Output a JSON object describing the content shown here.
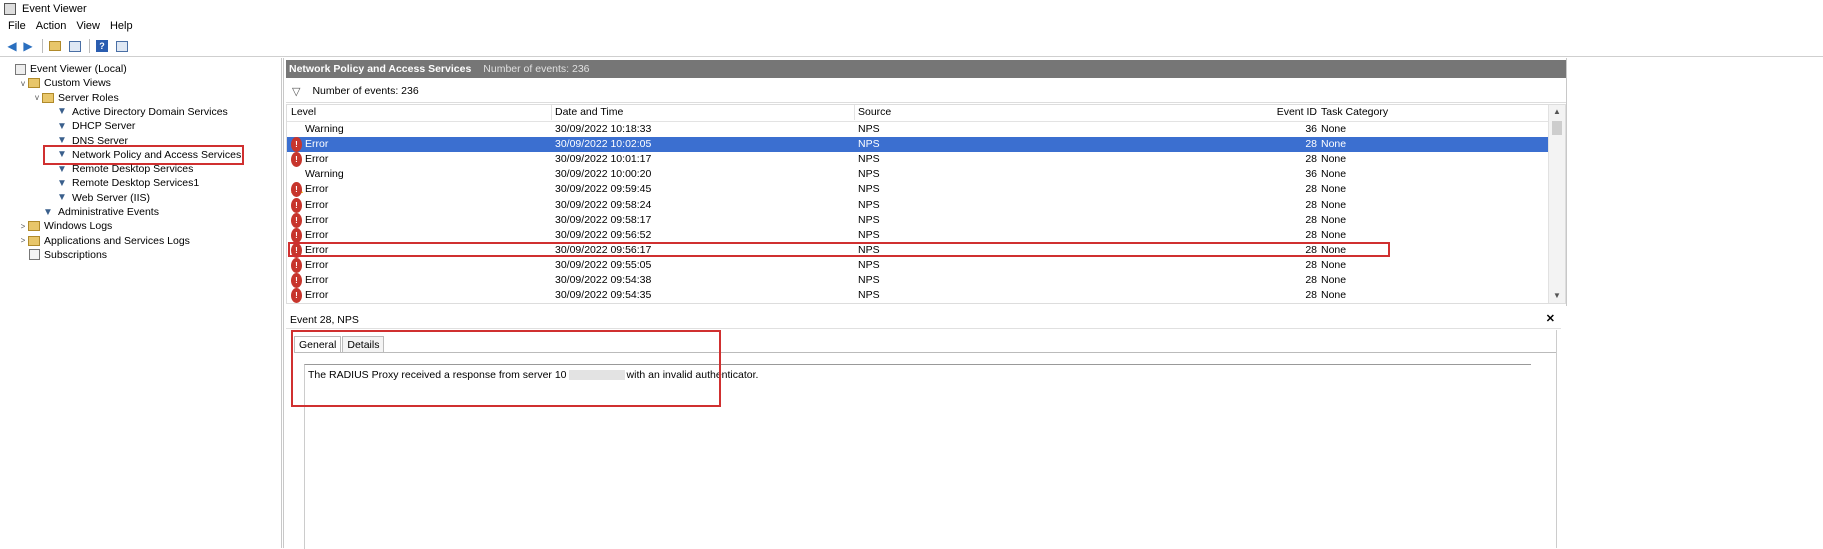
{
  "window": {
    "title": "Event Viewer"
  },
  "menu": {
    "items": [
      "File",
      "Action",
      "View",
      "Help"
    ]
  },
  "tree": {
    "items": [
      {
        "label": "Event Viewer (Local)",
        "icon": "computer-icon",
        "level": 0,
        "exp": ""
      },
      {
        "label": "Custom Views",
        "icon": "folder-icon",
        "level": 1,
        "exp": "v"
      },
      {
        "label": "Server Roles",
        "icon": "folder-icon",
        "level": 2,
        "exp": "v"
      },
      {
        "label": "Active Directory Domain Services",
        "icon": "filter-icon",
        "level": 3,
        "exp": ""
      },
      {
        "label": "DHCP Server",
        "icon": "filter-icon",
        "level": 3,
        "exp": ""
      },
      {
        "label": "DNS Server",
        "icon": "filter-icon",
        "level": 3,
        "exp": ""
      },
      {
        "label": "Network Policy and Access Services",
        "icon": "filter-icon",
        "level": 3,
        "exp": "",
        "highlighted": true
      },
      {
        "label": "Remote Desktop Services",
        "icon": "filter-icon",
        "level": 3,
        "exp": ""
      },
      {
        "label": "Remote Desktop Services1",
        "icon": "filter-icon",
        "level": 3,
        "exp": ""
      },
      {
        "label": "Web Server (IIS)",
        "icon": "filter-icon",
        "level": 3,
        "exp": ""
      },
      {
        "label": "Administrative Events",
        "icon": "filter-icon",
        "level": 2,
        "exp": ""
      },
      {
        "label": "Windows Logs",
        "icon": "folder-icon",
        "level": 1,
        "exp": ">"
      },
      {
        "label": "Applications and Services Logs",
        "icon": "folder-icon",
        "level": 1,
        "exp": ">"
      },
      {
        "label": "Subscriptions",
        "icon": "subscriptions-icon",
        "level": 1,
        "exp": ""
      }
    ]
  },
  "panel": {
    "title": "Network Policy and Access Services",
    "count_label": "Number of events: 236",
    "filter_count": "Number of events: 236"
  },
  "grid": {
    "columns": [
      "Level",
      "Date and Time",
      "Source",
      "Event ID",
      "Task Category"
    ],
    "rows": [
      {
        "level": "Warning",
        "date": "30/09/2022 10:18:33",
        "source": "NPS",
        "id": "36",
        "task": "None"
      },
      {
        "level": "Error",
        "date": "30/09/2022 10:02:05",
        "source": "NPS",
        "id": "28",
        "task": "None",
        "selected": true
      },
      {
        "level": "Error",
        "date": "30/09/2022 10:01:17",
        "source": "NPS",
        "id": "28",
        "task": "None"
      },
      {
        "level": "Warning",
        "date": "30/09/2022 10:00:20",
        "source": "NPS",
        "id": "36",
        "task": "None"
      },
      {
        "level": "Error",
        "date": "30/09/2022 09:59:45",
        "source": "NPS",
        "id": "28",
        "task": "None"
      },
      {
        "level": "Error",
        "date": "30/09/2022 09:58:24",
        "source": "NPS",
        "id": "28",
        "task": "None"
      },
      {
        "level": "Error",
        "date": "30/09/2022 09:58:17",
        "source": "NPS",
        "id": "28",
        "task": "None"
      },
      {
        "level": "Error",
        "date": "30/09/2022 09:56:52",
        "source": "NPS",
        "id": "28",
        "task": "None"
      },
      {
        "level": "Error",
        "date": "30/09/2022 09:56:17",
        "source": "NPS",
        "id": "28",
        "task": "None"
      },
      {
        "level": "Error",
        "date": "30/09/2022 09:55:05",
        "source": "NPS",
        "id": "28",
        "task": "None"
      },
      {
        "level": "Error",
        "date": "30/09/2022 09:54:38",
        "source": "NPS",
        "id": "28",
        "task": "None"
      },
      {
        "level": "Error",
        "date": "30/09/2022 09:54:35",
        "source": "NPS",
        "id": "28",
        "task": "None"
      }
    ]
  },
  "detail": {
    "header": "Event 28, NPS",
    "tabs": [
      "General",
      "Details"
    ],
    "description_prefix": "The RADIUS Proxy received a response from server 10",
    "description_suffix": "with an invalid authenticator."
  },
  "colors": {
    "selection": "#3b6fd0",
    "highlight": "#d03030",
    "header_bar": "#767676",
    "error": "#c7352c",
    "warning": "#f0c000"
  }
}
